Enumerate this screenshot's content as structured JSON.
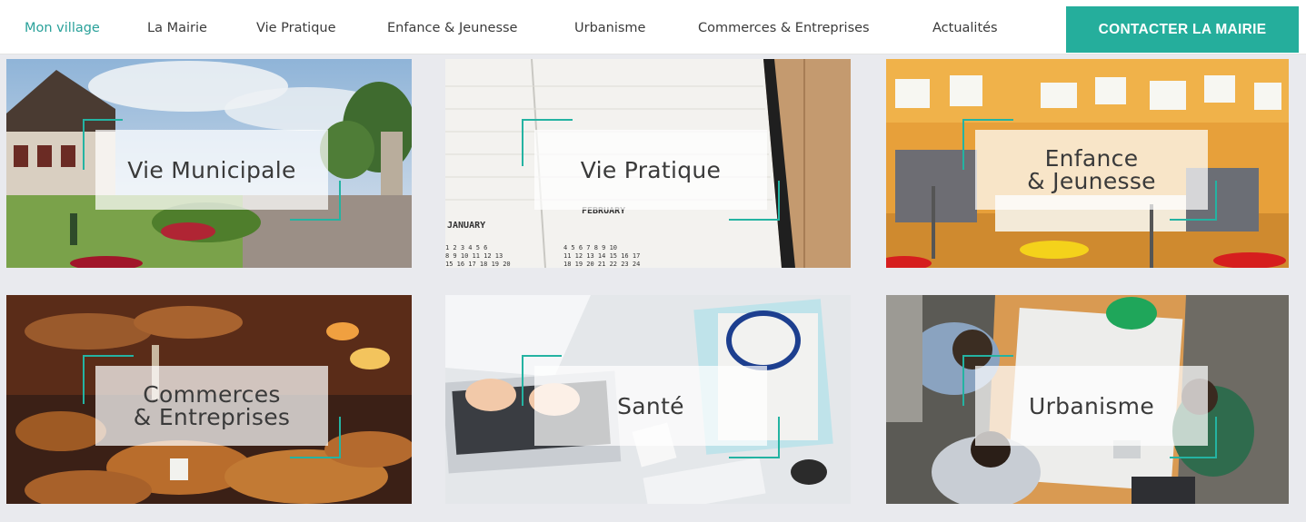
{
  "nav": {
    "items": [
      {
        "label": "Mon village",
        "active": true
      },
      {
        "label": "La Mairie",
        "active": false
      },
      {
        "label": "Vie Pratique",
        "active": false
      },
      {
        "label": "Enfance & Jeunesse",
        "active": false
      },
      {
        "label": "Urbanisme",
        "active": false
      },
      {
        "label": "Commerces & Entreprises",
        "active": false
      },
      {
        "label": "Actualités",
        "active": false
      }
    ],
    "contact_button": "CONTACTER LA MAIRIE"
  },
  "colors": {
    "accent": "#25ae9c",
    "active_nav": "#2aa19a",
    "bracket": "#24b3a2"
  },
  "tiles": [
    {
      "label": "Vie Municipale",
      "image": "village-town-hall-photo"
    },
    {
      "label": "Vie Pratique",
      "image": "notebook-calendar-photo"
    },
    {
      "label": "Enfance\n& Jeunesse",
      "image": "classroom-photo"
    },
    {
      "label": "Commerces\n& Entreprises",
      "image": "bakery-pastries-photo"
    },
    {
      "label": "Santé",
      "image": "doctor-desk-laptop-stethoscope-photo"
    },
    {
      "label": "Urbanisme",
      "image": "architects-blueprints-photo"
    }
  ],
  "calendar": {
    "month_1": "JANUARY",
    "month_2": "FEBRUARY"
  }
}
